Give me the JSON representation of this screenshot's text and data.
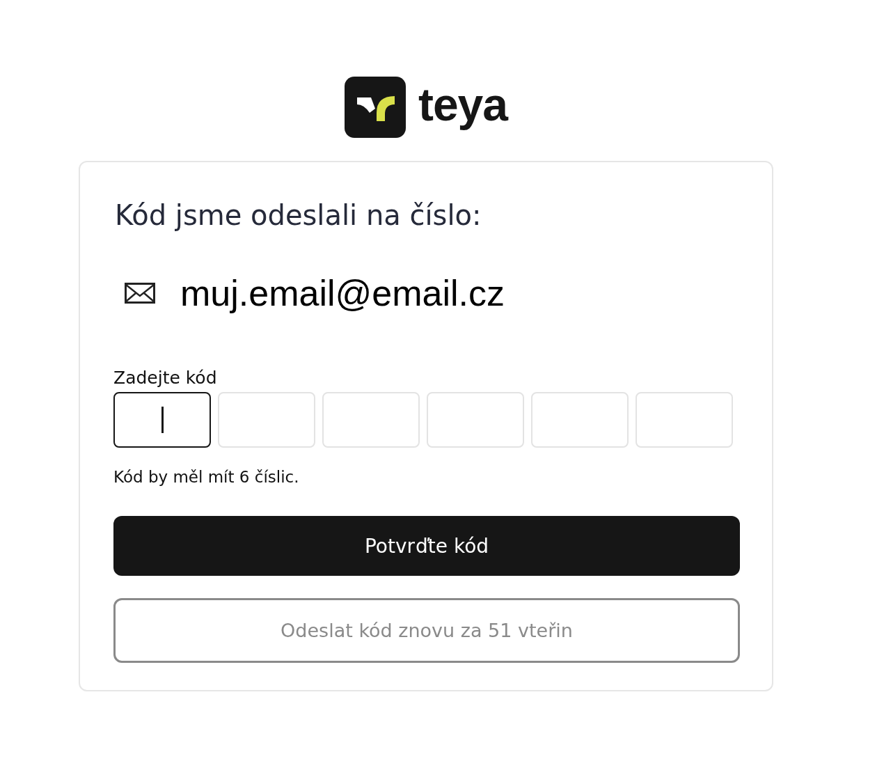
{
  "logo": {
    "wordmark": "teya"
  },
  "heading": "Kód jsme odeslali na číslo:",
  "contact": {
    "value": "muj.email@email.cz"
  },
  "code_field": {
    "label": "Zadejte kód",
    "boxes": [
      {
        "focused": true
      },
      {
        "focused": false
      },
      {
        "focused": false
      },
      {
        "focused": false
      },
      {
        "focused": false
      },
      {
        "focused": false
      }
    ],
    "hint": "Kód by měl mít 6 číslic."
  },
  "confirm_button": {
    "label": "Potvrďte kód"
  },
  "resend_button": {
    "label": "Odeslat kód znovu za 51 vteřin",
    "disabled": true
  }
}
